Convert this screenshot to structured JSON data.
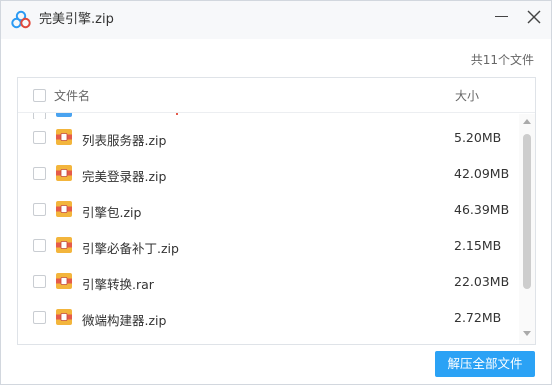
{
  "window": {
    "title": "完美引擎.zip",
    "app_icon": "baidu-netdisk-cloud-icon",
    "minimize_icon": "minimize-icon",
    "close_icon": "close-icon"
  },
  "summary": {
    "file_count_label": "共11个文件"
  },
  "list": {
    "header": {
      "name_label": "文件名",
      "size_label": "大小"
    },
    "rows": [
      {
        "name": "列表服务器.zip",
        "size": "5.20MB",
        "icon": "archive-file-icon"
      },
      {
        "name": "完美登录器.zip",
        "size": "42.09MB",
        "icon": "archive-file-icon"
      },
      {
        "name": "引擎包.zip",
        "size": "46.39MB",
        "icon": "archive-file-icon"
      },
      {
        "name": "引擎必备补丁.zip",
        "size": "2.15MB",
        "icon": "archive-file-icon"
      },
      {
        "name": "引擎转换.rar",
        "size": "22.03MB",
        "icon": "archive-file-icon"
      },
      {
        "name": "微端构建器.zip",
        "size": "2.72MB",
        "icon": "archive-file-icon"
      }
    ]
  },
  "footer": {
    "extract_all_label": "解压全部文件"
  },
  "colors": {
    "accent": "#2ba2f5",
    "archive_icon_bg": "#f3b53c",
    "archive_icon_band": "#e55b4b"
  }
}
